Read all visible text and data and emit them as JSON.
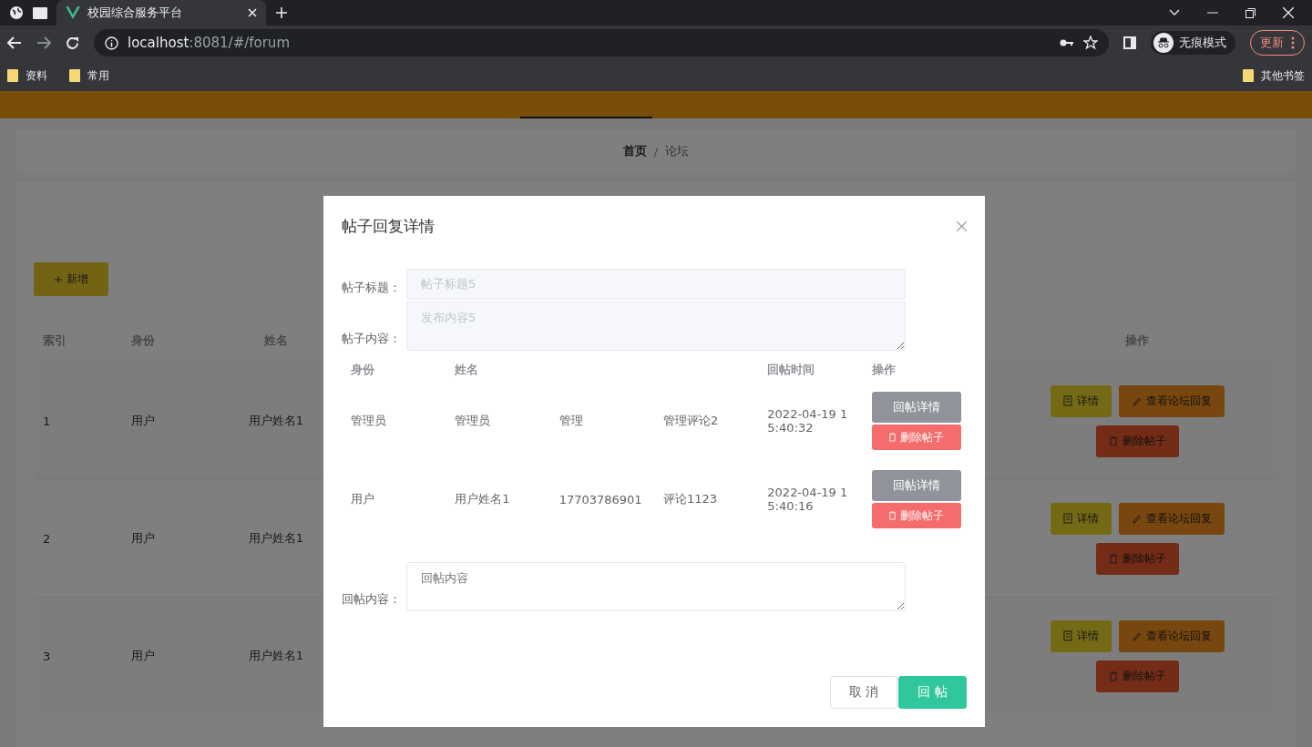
{
  "browser": {
    "tabs": [
      {
        "title": "校园综合服务平台",
        "selected": true
      }
    ],
    "address": {
      "host": "localhost",
      "path": ":8081/#/forum"
    },
    "profile": "无痕模式",
    "update": "更新",
    "bookmarks": [
      "资料",
      "常用"
    ],
    "other_bookmarks": "其他书签"
  },
  "page": {
    "breadcrumb": [
      "首页",
      "/",
      "论坛"
    ],
    "add_button": "新增",
    "table": {
      "columns": [
        {
          "label": "索引"
        },
        {
          "label": "身份"
        },
        {
          "label": "姓名"
        },
        {
          "label": "操作"
        }
      ],
      "rows": [
        {
          "index": "1",
          "role": "用户",
          "name": "用户姓名1",
          "actions": [
            "详情",
            "查看论坛回复",
            "删除帖子"
          ]
        },
        {
          "index": "2",
          "role": "用户",
          "name": "用户姓名1",
          "actions": [
            "详情",
            "查看论坛回复",
            "删除帖子"
          ]
        },
        {
          "index": "3",
          "role": "用户",
          "name": "用户姓名1",
          "actions": [
            "详情",
            "查看论坛回复",
            "删除帖子"
          ]
        }
      ]
    }
  },
  "dialog": {
    "title": "帖子回复详情",
    "fields": [
      {
        "kind": "input",
        "label": "帖子标题：",
        "value": "帖子标题5",
        "disabled": true
      },
      {
        "kind": "textarea",
        "label": "帖子内容：",
        "value": "发布内容5",
        "disabled": true
      }
    ],
    "table": {
      "columns": [
        {
          "label": "身份"
        },
        {
          "label": "姓名"
        },
        {},
        {},
        {
          "label": "回帖时间"
        },
        {
          "label": "操作"
        }
      ],
      "rows": [
        {
          "role": "管理员",
          "name": "管理员",
          "phone": "管理",
          "content": "管理评论2",
          "time": "2022-04-19 15:40:32",
          "actions": [
            "回帖详情",
            "删除帖子"
          ]
        },
        {
          "role": "用户",
          "name": "用户姓名1",
          "phone": "17703786901",
          "content": "评论1123",
          "time": "2022-04-19 15:40:16",
          "actions": [
            "回帖详情",
            "删除帖子"
          ]
        }
      ]
    },
    "reply": {
      "label": "回帖内容：",
      "placeholder": "回帖内容"
    },
    "buttons": [
      {
        "kind": "cancel",
        "label": "取 消"
      },
      {
        "kind": "primary",
        "label": "回 帖"
      }
    ]
  }
}
